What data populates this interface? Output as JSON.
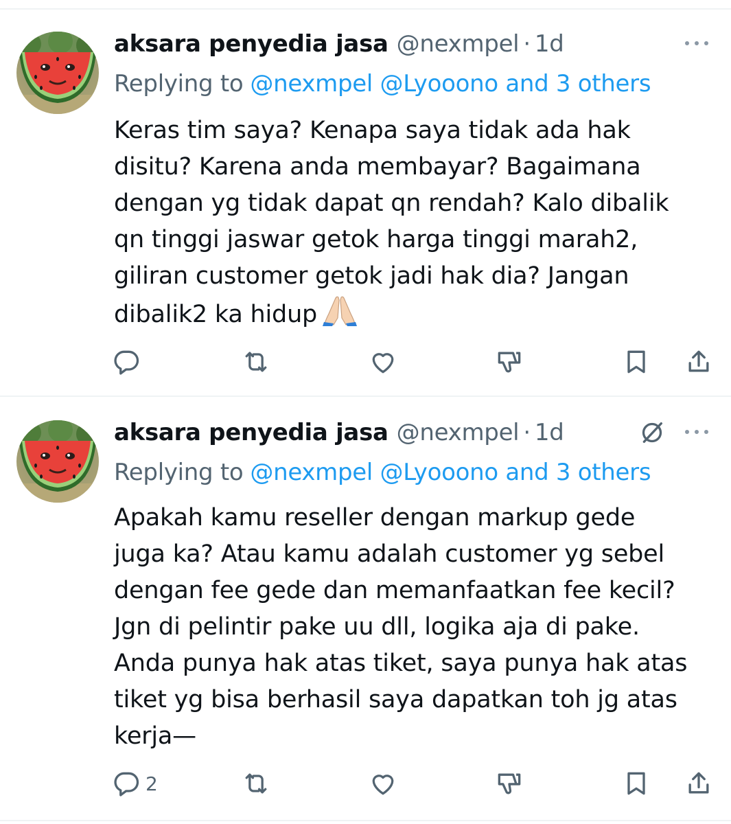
{
  "tweets": [
    {
      "author_name": "aksara penyedia jasa",
      "handle": "@nexmpel",
      "separator": "·",
      "time": "1d",
      "replying_prefix": "Replying to",
      "replying_mentions": "@nexmpel @Lyooono and 3 others",
      "body_lines": [
        "Keras tim saya? Kenapa saya tidak ada hak",
        "disitu? Karena anda membayar? Bagaimana",
        "dengan yg tidak dapat qn rendah? Kalo dibalik",
        "qn tinggi jaswar getok harga tinggi marah2,",
        "giliran customer getok jadi hak dia? Jangan",
        "dibalik2 ka hidup"
      ],
      "emoji": "folded-hands",
      "reply_count": "",
      "icons": [
        "reply-icon",
        "retweet-icon",
        "like-icon",
        "downvote-icon",
        "bookmark-icon",
        "share-icon"
      ]
    },
    {
      "author_name": "aksara penyedia jasa",
      "handle": "@nexmpel",
      "separator": "·",
      "time": "1d",
      "replying_prefix": "Replying to",
      "replying_mentions": "@nexmpel @Lyooono and 3 others",
      "body_lines": [
        "Apakah kamu reseller dengan markup gede",
        "juga ka? Atau kamu adalah customer yg sebel",
        "dengan fee gede dan memanfaatkan fee kecil?",
        "Jgn di pelintir pake uu dll, logika aja di pake.",
        "Anda punya hak atas tiket, saya punya hak atas",
        "tiket yg bisa berhasil saya dapatkan toh jg atas",
        "kerja—"
      ],
      "reply_count": "2",
      "icons": [
        "grok-icon",
        "reply-icon",
        "retweet-icon",
        "like-icon",
        "downvote-icon",
        "bookmark-icon",
        "share-icon"
      ]
    }
  ],
  "colors": {
    "text": "#0f1419",
    "secondary": "#536471",
    "link": "#1d9bf0",
    "divider": "#eff3f4"
  }
}
